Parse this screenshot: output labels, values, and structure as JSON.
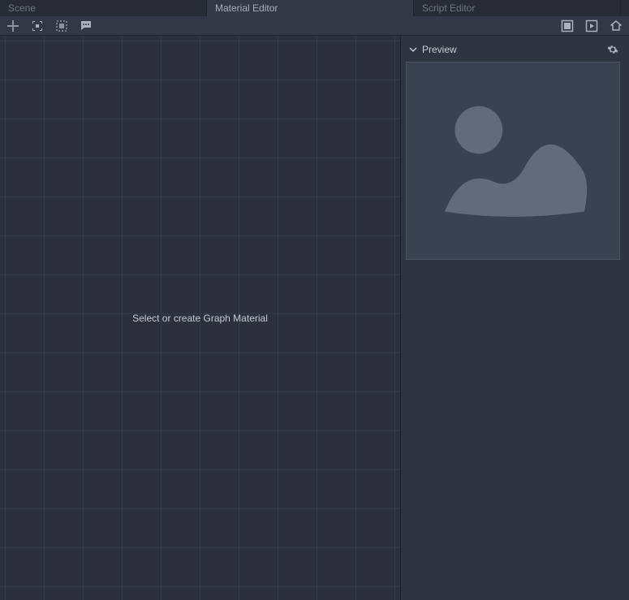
{
  "tabs": [
    {
      "label": "Scene",
      "active": false
    },
    {
      "label": "Material Editor",
      "active": true
    },
    {
      "label": "Script Editor",
      "active": false
    }
  ],
  "toolbar_icons": {
    "add": "add-node",
    "snap": "snap-grid",
    "select": "select-area",
    "chat": "comments"
  },
  "right_icons": {
    "expand": "expand-view",
    "play": "play-preview",
    "home": "home"
  },
  "graph": {
    "placeholder": "Select or create Graph Material"
  },
  "preview": {
    "title": "Preview",
    "settings_icon": "gear"
  }
}
